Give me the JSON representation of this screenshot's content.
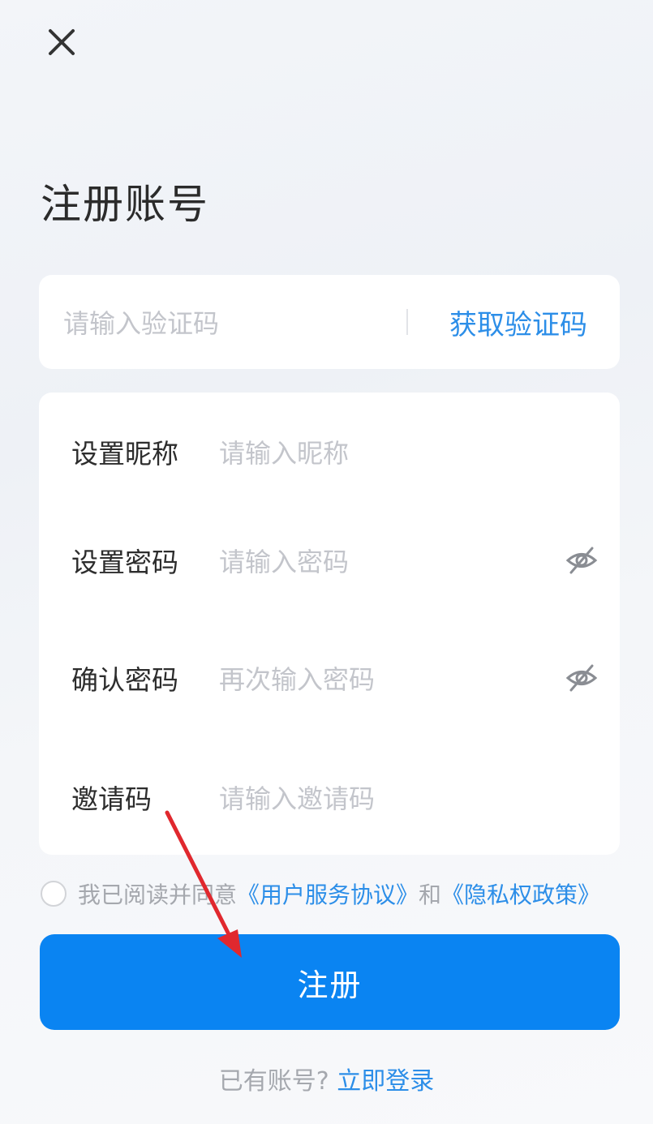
{
  "header": {
    "close_icon": "close-icon",
    "title": "注册账号"
  },
  "verification": {
    "placeholder": "请输入验证码",
    "get_code_label": "获取验证码"
  },
  "form": {
    "rows": [
      {
        "label": "设置昵称",
        "placeholder": "请输入昵称"
      },
      {
        "label": "设置密码",
        "placeholder": "请输入密码",
        "icon": "eye-slash-icon"
      },
      {
        "label": "确认密码",
        "placeholder": "再次输入密码",
        "icon": "eye-slash-icon"
      },
      {
        "label": "邀请码",
        "placeholder": "请输入邀请码"
      }
    ]
  },
  "agreement": {
    "prefix": "我已阅读并同意",
    "terms_link": "《用户服务协议》",
    "and": "和",
    "privacy_link": "《隐私权政策》"
  },
  "submit": {
    "label": "注册"
  },
  "footer": {
    "question": "已有账号?",
    "login_link": "立即登录"
  },
  "colors": {
    "accent": "#0a84f2",
    "link": "#2c8ee8",
    "annotation_arrow": "#e0282e"
  }
}
